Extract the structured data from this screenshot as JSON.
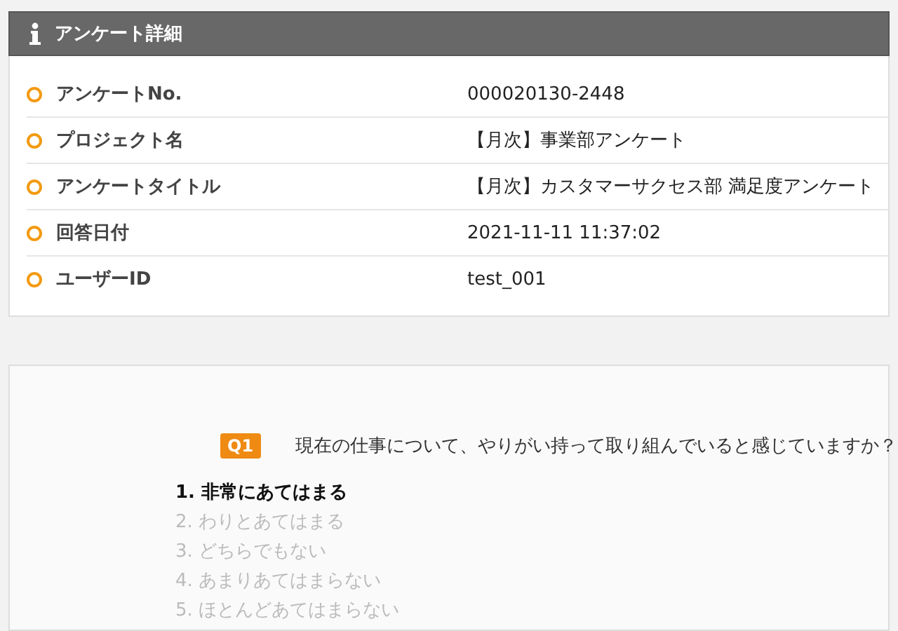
{
  "panel": {
    "title": "アンケート詳細"
  },
  "details": [
    {
      "label": "アンケートNo.",
      "value": "000020130-2448"
    },
    {
      "label": "プロジェクト名",
      "value": "【月次】事業部アンケート"
    },
    {
      "label": "アンケートタイトル",
      "value": "【月次】カスタマーサクセス部 満足度アンケート"
    },
    {
      "label": "回答日付",
      "value": "2021-11-11 11:37:02"
    },
    {
      "label": "ユーザーID",
      "value": "test_001"
    }
  ],
  "question": {
    "badge": "Q1",
    "text": "現在の仕事について、やりがい持って取り組んでいると感じていますか？",
    "options": [
      {
        "number": "1.",
        "label": "非常にあてはまる",
        "selected": true
      },
      {
        "number": "2.",
        "label": "わりとあてはまる",
        "selected": false
      },
      {
        "number": "3.",
        "label": "どちらでもない",
        "selected": false
      },
      {
        "number": "4.",
        "label": "あまりあてはまらない",
        "selected": false
      },
      {
        "number": "5.",
        "label": "ほとんどあてはまらない",
        "selected": false
      }
    ]
  }
}
